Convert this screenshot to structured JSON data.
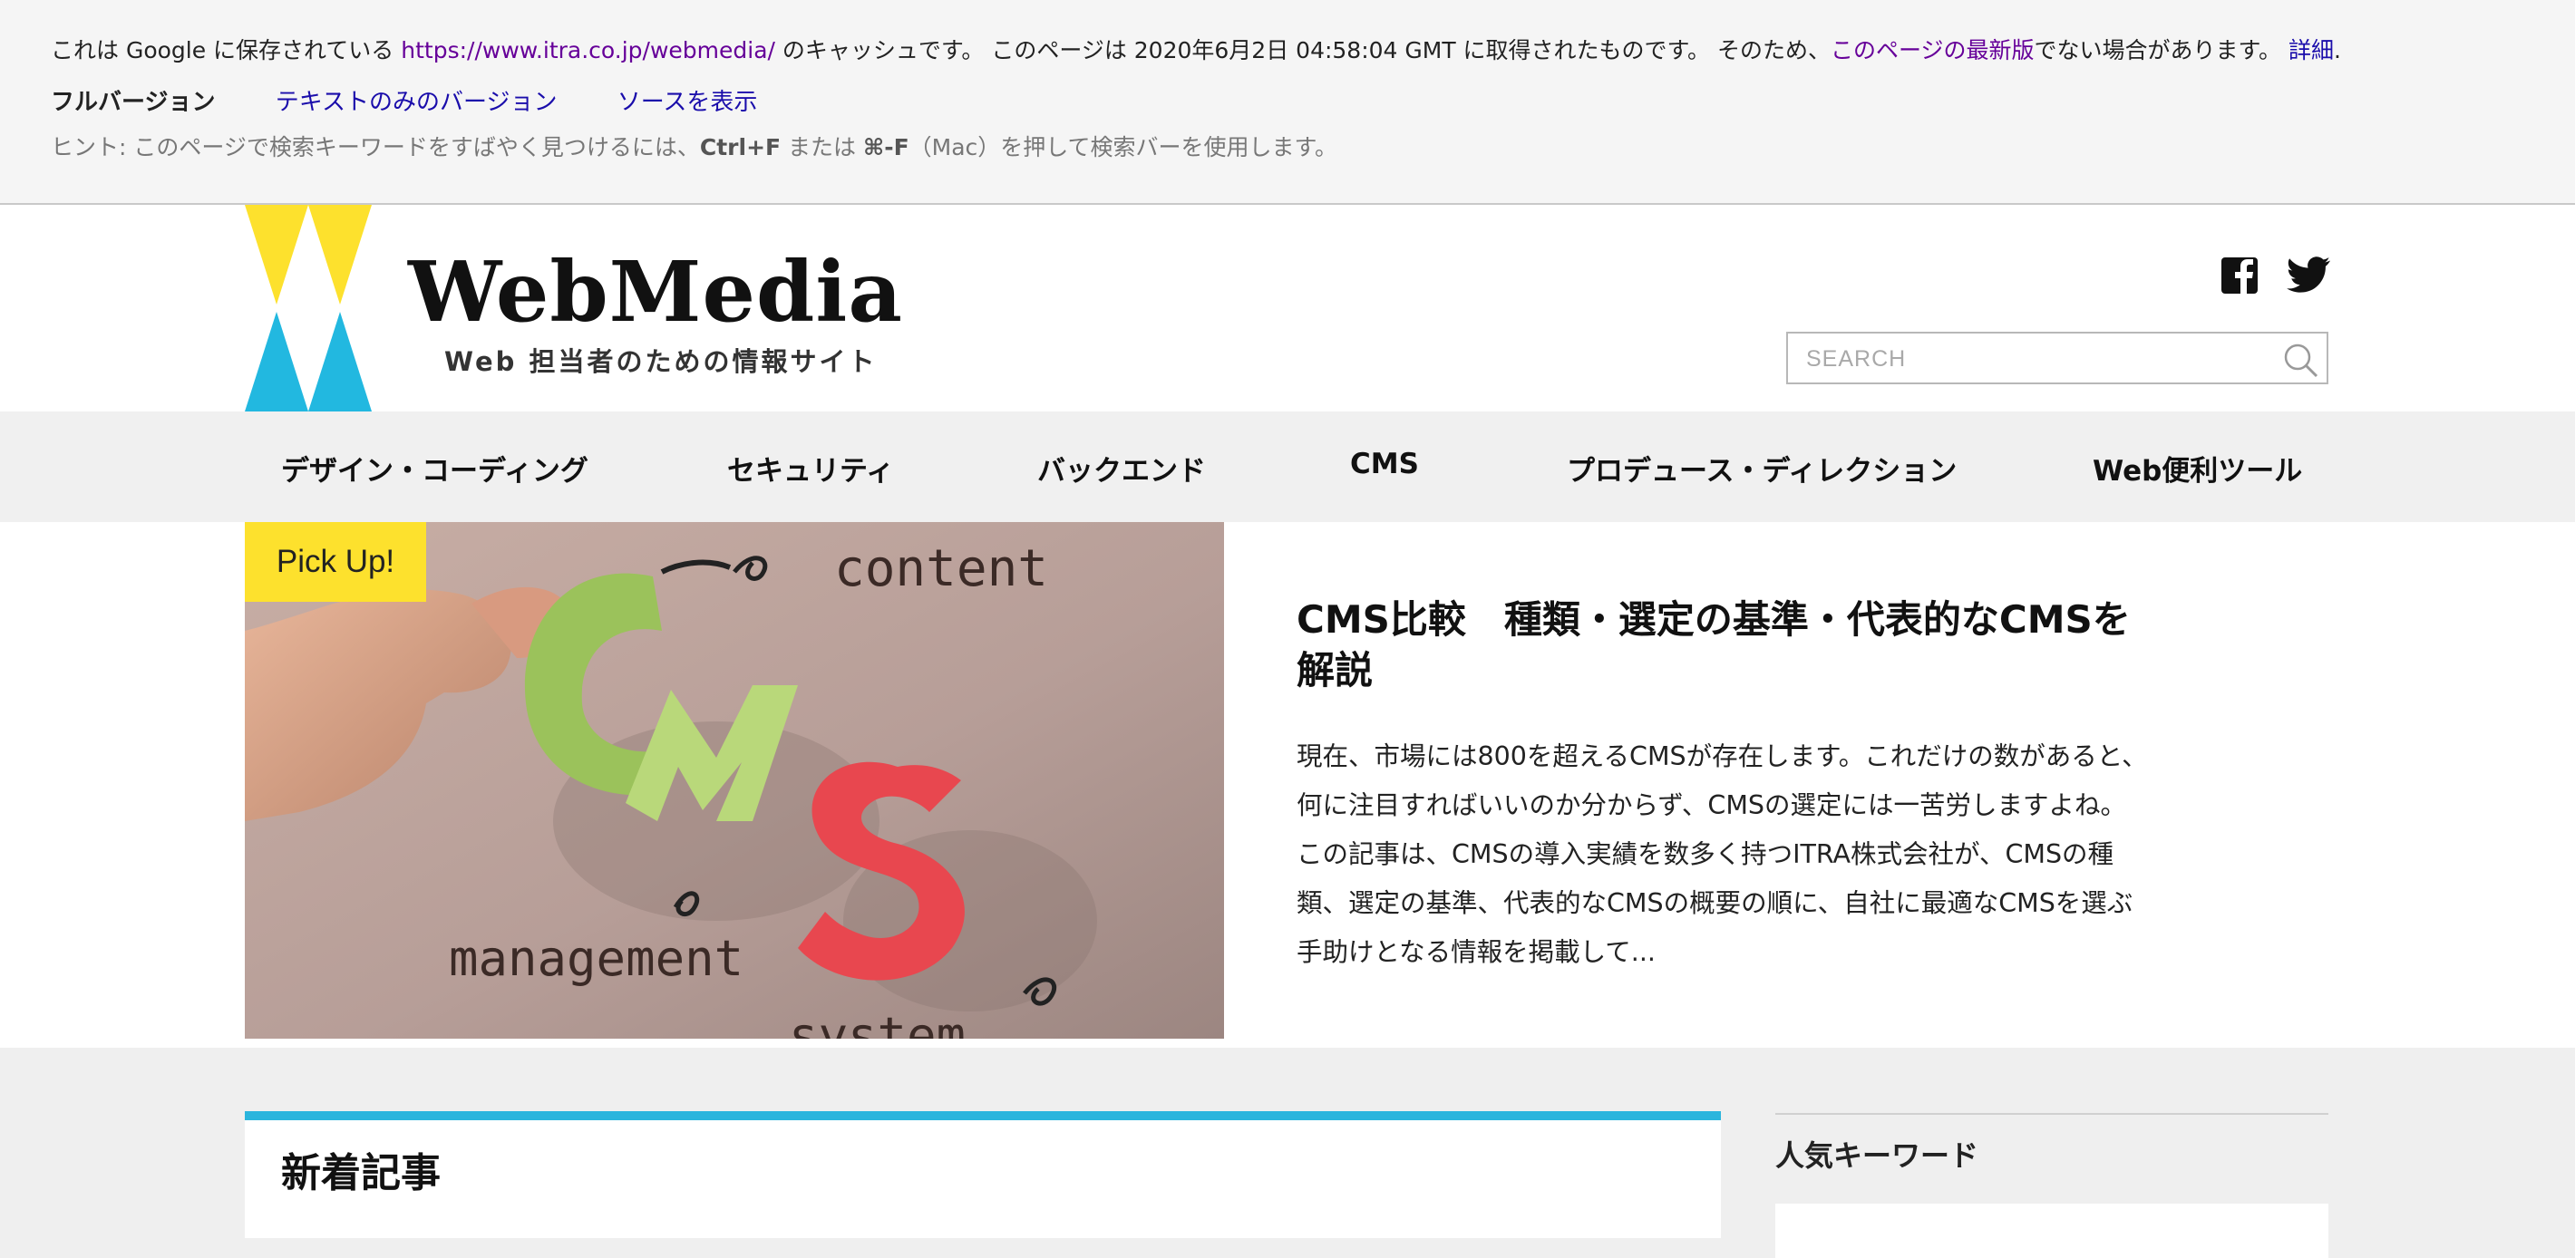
{
  "cache_banner": {
    "prefix": "これは Google に保存されている ",
    "cached_url": "https://www.itra.co.jp/webmedia/",
    "middle": " のキャッシュです。 このページは 2020年6月2日 04:58:04 GMT に取得されたものです。 そのため、",
    "latest_link": "このページの最新版",
    "suffix": "でない場合があります。 ",
    "details_link": "詳細",
    "details_period": ".",
    "full_version": "フルバージョン",
    "text_only": "テキストのみのバージョン",
    "view_source": "ソースを表示",
    "hint_prefix": "ヒント: このページで検索キーワードをすばやく見つけるには、",
    "hint_ctrlf": "Ctrl+F",
    "hint_or": " または ",
    "hint_cmdf": "⌘-F",
    "hint_suffix": "（Mac）を押して検索バーを使用します。"
  },
  "header": {
    "logo_word": "WebMedia",
    "logo_tagline": "Web 担当者のための情報サイト",
    "search_placeholder": "SEARCH",
    "social": [
      "facebook-icon",
      "twitter-icon"
    ]
  },
  "nav": {
    "items": [
      "デザイン・コーディング",
      "セキュリティ",
      "バックエンド",
      "CMS",
      "プロデュース・ディレクション",
      "Web便利ツール"
    ]
  },
  "pickup": {
    "badge": "Pick Up!",
    "image_words": [
      "content",
      "CMS",
      "management",
      "system"
    ],
    "title": "CMS比較　種類・選定の基準・代表的なCMSを解説",
    "excerpt": "現在、市場には800を超えるCMSが存在します。これだけの数があると、何に注目すればいいのか分からず、CMSの選定には一苦労しますよね。この記事は、CMSの導入実績を数多く持つITRA株式会社が、CMSの種類、選定の基準、代表的なCMSの概要の順に、自社に最適なCMSを選ぶ手助けとなる情報を掲載して..."
  },
  "sections": {
    "new_articles": "新着記事",
    "popular_keywords": "人気キーワード"
  },
  "colors": {
    "logo_yellow": "#fde12d",
    "logo_blue": "#22b8e0",
    "accent_blue": "#2bb5dd",
    "link_blue": "#1a0dab",
    "link_visited": "#660099"
  }
}
